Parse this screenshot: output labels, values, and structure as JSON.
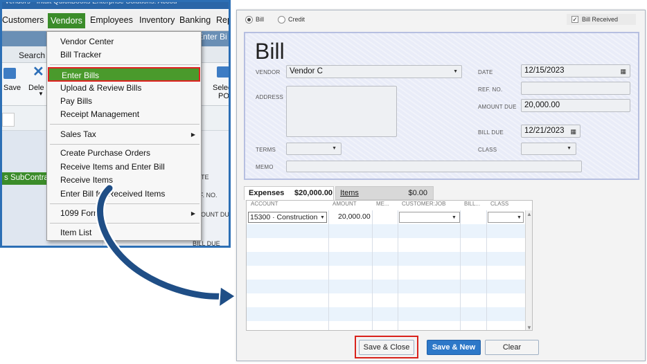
{
  "left_window": {
    "title": "Vendors - Intuit QuickBooks Enterprise Solutions: Accou",
    "menubar": [
      "Customers",
      "Vendors",
      "Employees",
      "Inventory",
      "Banking",
      "Rep"
    ],
    "header_tab": "Enter Bi",
    "search_label": "Search",
    "toolbar": {
      "save": "Save",
      "delete": "Dele",
      "select_po_line1": "Selec",
      "select_po_line2": "PO"
    },
    "sub_tab": "s SubContra",
    "field_labels": [
      "TE",
      "F. NO.",
      "OUNT DU",
      "BILL DUE"
    ],
    "vendors_menu": {
      "groups": [
        [
          "Vendor Center",
          "Bill Tracker"
        ],
        [
          "Enter Bills",
          "Upload & Review Bills",
          "Pay Bills",
          "Receipt Management"
        ],
        [
          "Sales Tax"
        ],
        [
          "Create Purchase Orders",
          "Receive Items and Enter Bill",
          "Receive Items",
          "Enter Bill for Received Items"
        ],
        [
          "1099 Forms"
        ],
        [
          "Item List"
        ]
      ],
      "highlighted": "Enter Bills"
    }
  },
  "bill": {
    "radio_bill": "Bill",
    "radio_credit": "Credit",
    "bill_received_label": "Bill Received",
    "bill_received_checked": true,
    "title": "Bill",
    "vendor_label": "VENDOR",
    "vendor_value": "Vendor C",
    "address_label": "ADDRESS",
    "date_label": "DATE",
    "date_value": "12/15/2023",
    "ref_label": "REF. NO.",
    "ref_value": "",
    "amount_due_label": "AMOUNT DUE",
    "amount_due_value": "20,000.00",
    "bill_due_label": "BILL DUE",
    "bill_due_value": "12/21/2023",
    "terms_label": "TERMS",
    "class_label": "CLASS",
    "memo_label": "MEMO",
    "tab_expenses_label": "Expenses",
    "tab_expenses_amount": "$20,000.00",
    "tab_items_label": "Items",
    "tab_items_amount": "$0.00",
    "grid_headers": [
      "ACCOUNT",
      "AMOUNT",
      "ME...",
      "CUSTOMER:JOB",
      "BILL...",
      "CLASS"
    ],
    "grid_rows": [
      {
        "account": "15300 · Construction",
        "amount": "20,000.00"
      }
    ],
    "buttons": {
      "save_close": "Save & Close",
      "save_new": "Save & New",
      "clear": "Clear"
    }
  },
  "colors": {
    "menu_highlight": "#3b8c2a",
    "callout_red": "#d9221b",
    "save_new_blue": "#2d78c8",
    "arrow": "#1f4e86"
  }
}
